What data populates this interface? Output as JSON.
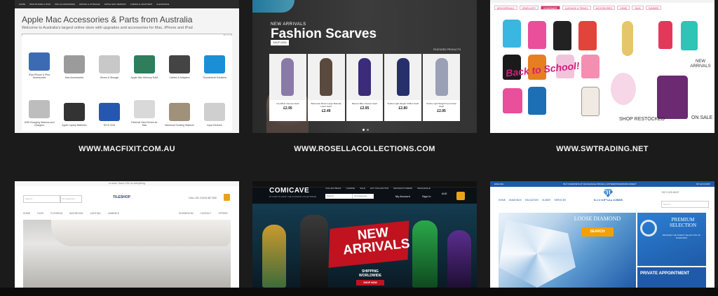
{
  "captions": [
    "WWW.MACFIXIT.COM.AU",
    "WWW.ROSELLACOLLECTIONS.COM",
    "WWW.SWTRADING.NET"
  ],
  "macfixit": {
    "nav": [
      "HOME",
      "IPAD IPHONE & IPOD",
      "MAC ACCESSORIES",
      "DRIVES & STORAGE",
      "APPLE MAC REPAIRS",
      "CABLES & ADAPTERS",
      "CLEARANCE"
    ],
    "title": "Apple Mac Accessories & Parts from Australia",
    "subtitle": "Welcome to Australia's largest online store with upgrades and accessories for Mac, iPhone and iPad",
    "search_placeholder": "Search...",
    "categories": [
      {
        "label": "iPad iPhone & iPod Accessories",
        "color": "#3d6bb3"
      },
      {
        "label": "Mac Accessories",
        "color": "#9b9b9b"
      },
      {
        "label": "Drives & Storage",
        "color": "#c8c8c8"
      },
      {
        "label": "Apple Mac Memory RAM",
        "color": "#2e7d5c"
      },
      {
        "label": "Cables & Adapters",
        "color": "#444444"
      },
      {
        "label": "Thunderbolt Solutions",
        "color": "#1a8fd6"
      },
      {
        "label": "USB Charging Stations and Chargers",
        "color": "#bdbdbd"
      },
      {
        "label": "Apple Laptop Batteries",
        "color": "#333333"
      },
      {
        "label": "DIYD SSD",
        "color": "#2458b0"
      },
      {
        "label": "External Hard Drives for Mac",
        "color": "#d9d9d9"
      },
      {
        "label": "Macbook Docking Stations",
        "color": "#a0917a"
      },
      {
        "label": "Input Devices",
        "color": "#cfcfcf"
      }
    ]
  },
  "rosella": {
    "eyebrow": "NEW ARRIVALS",
    "title": "Fashion Scarves",
    "shop_now": "SHOP NOW",
    "featured": "FEATURED PRODUCTS",
    "products": [
      {
        "name": "Lily White Viscose Scarf",
        "price": "£2.95",
        "color": "#8a7aa8"
      },
      {
        "name": "Bohemian Brown Large Butterfly Lotion Scarf",
        "price": "£2.49",
        "color": "#5a4a3e"
      },
      {
        "name": "Maroon Blue Viscose Scarf",
        "price": "£2.95",
        "color": "#3b2b7a"
      },
      {
        "name": "Scarlet Light Weight Chiffon Scarf",
        "price": "£2.80",
        "color": "#27306b"
      },
      {
        "name": "Ombre Light Weight Feel Cotton Scarf",
        "price": "£2.95",
        "color": "#9aa0b5"
      }
    ]
  },
  "swtrading": {
    "nav": [
      "NEW ARRIVALS",
      "JEWELLERY",
      "HOMEWARE",
      "LUGGAGE & TRAVEL",
      "ACCESSORIES",
      "HOME",
      "SALE",
      "SUMMER"
    ],
    "back_to_school": "Back to School!",
    "new_arrivals": "NEW ARRIVALS",
    "shop_restocked": "SHOP RESTOCKED",
    "on_sale": "ON SALE"
  },
  "tiles": {
    "topbar": "In-store: Save 10% on everything",
    "search_placeholder": "Search...",
    "search_category": "All Categories",
    "logo": "TILESHOP",
    "phone": "CALL US: 01234 567 890",
    "menu": [
      "HOME",
      "TILES",
      "FLOORING",
      "BATHROOM",
      "LIGHTING",
      "LAMINATE"
    ],
    "menu_right": [
      "SHOWROOM",
      "CONTACT",
      "OFFERS"
    ]
  },
  "comicave": {
    "logo": "COMICAVE",
    "tagline": "BY FANS TO FANS: THE ULTIMATE COLLECTIBLES",
    "menu": [
      "COLLECTIBLES",
      "LICENSE",
      "SALE",
      "HOT COLLECTION",
      "MANUFACTURERS",
      "WHOLESALE"
    ],
    "search_placeholder": "Search...",
    "search_category": "All Categories",
    "account": "My Account",
    "sign_in": "Sign In",
    "currency": "AUD",
    "hero_title": "NEW ARRIVALS",
    "shipping": "SHIPPING WORLDWIDE",
    "shop_now": "SHOP NOW"
  },
  "antwerp": {
    "topbar_left": "ENGLISH",
    "topbar_mid": "BUY DIAMONDS AT WHOLESALE PRICES | ANTWERPDIAMONDS.DIRECT",
    "topbar_right": "MY ACCOUNT",
    "logo": "ANTWERPDIAMONDS",
    "menu": [
      "HOME",
      "DIAMONDS",
      "EDUCATION",
      "GUIDES",
      "SERVICES"
    ],
    "phone": "+32 3 123 45 67",
    "search_placeholder": "Search...",
    "hero_title": "FIND YOUR PERFECT",
    "hero_sub": "LOOSE DIAMOND",
    "search_btn": "SEARCH",
    "premium": "PREMIUM SELECTION",
    "premium_text": "BROWSE THE FINEST SELECTION OF DIAMONDS",
    "appointment": "PRIVATE APPOINTMENT"
  }
}
